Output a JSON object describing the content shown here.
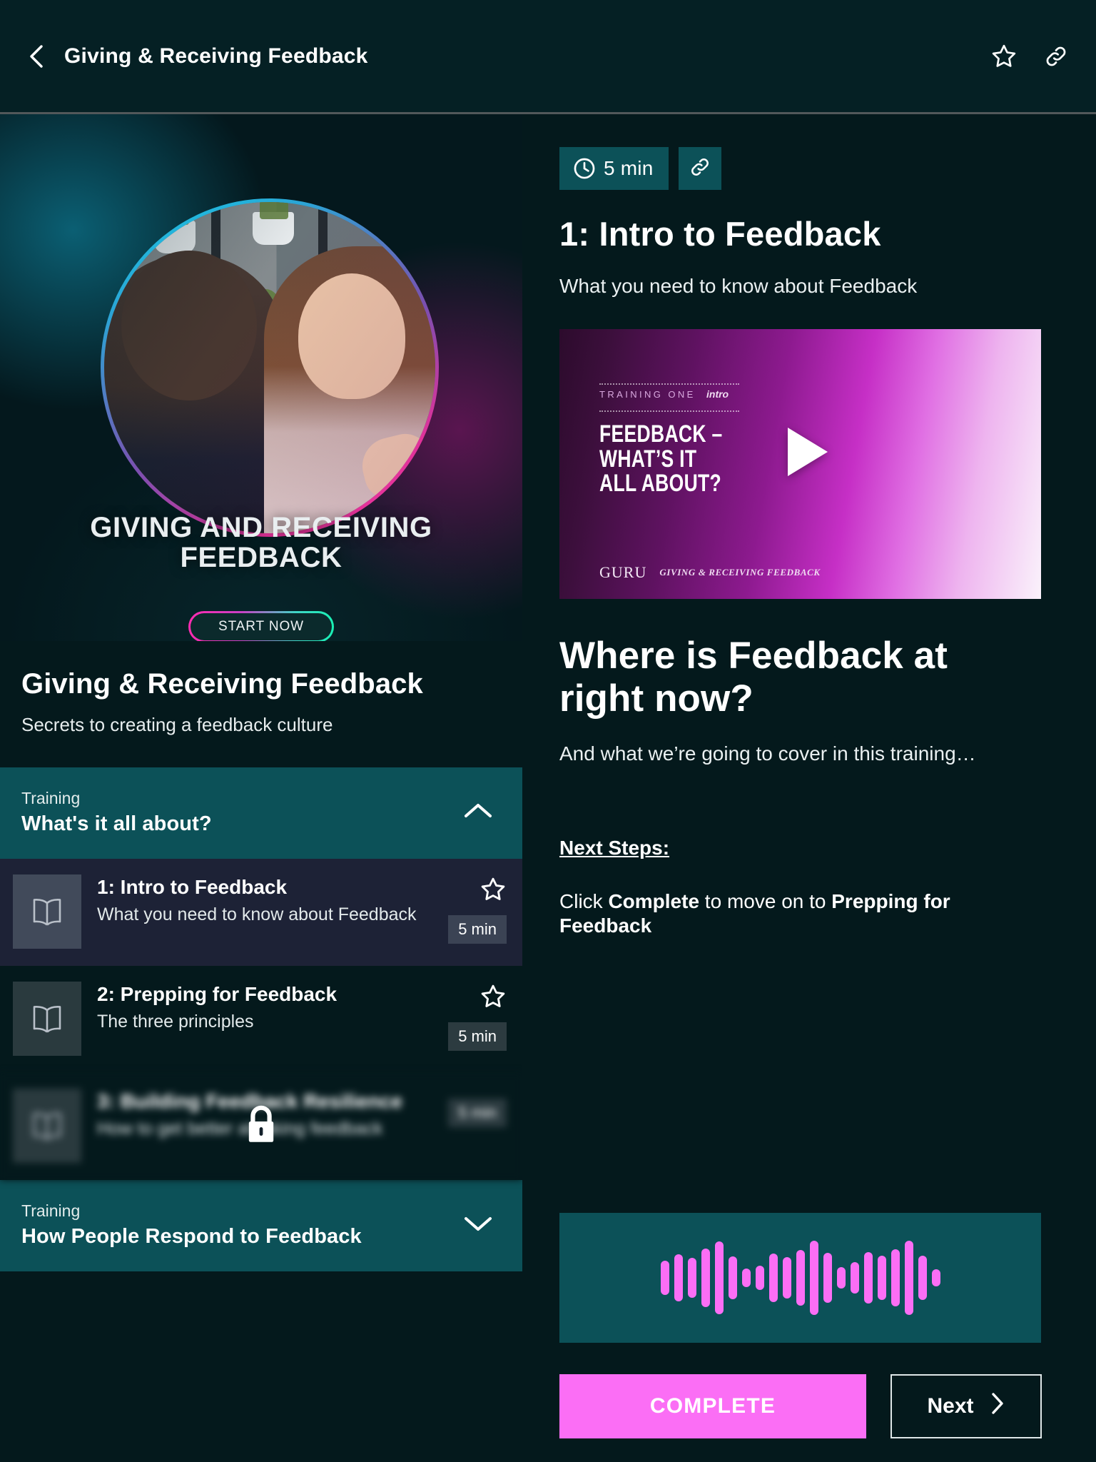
{
  "topbar": {
    "back_icon": "chevron-left-icon",
    "title": "Giving & Receiving Feedback",
    "favorite_icon": "star-outline-icon",
    "link_icon": "link-icon"
  },
  "hero": {
    "title": "GIVING AND RECEIVING FEEDBACK",
    "cta_label": "START NOW"
  },
  "course": {
    "title": "Giving & Receiving Feedback",
    "subtitle": "Secrets to creating a feedback culture"
  },
  "sections": [
    {
      "kicker": "Training",
      "name": "What's it all about?",
      "expanded": true,
      "chevron_icon": "chevron-up-icon"
    },
    {
      "kicker": "Training",
      "name": "How People Respond to Feedback",
      "expanded": false,
      "chevron_icon": "chevron-down-icon"
    }
  ],
  "lessons": [
    {
      "title": "1: Intro to Feedback",
      "subtitle": "What you need to know about Feedback",
      "duration": "5 min",
      "state": "active",
      "icon": "book-icon",
      "star_icon": "star-outline-icon"
    },
    {
      "title": "2: Prepping for Feedback",
      "subtitle": "The three principles",
      "duration": "5 min",
      "state": "available",
      "icon": "book-icon",
      "star_icon": "star-outline-icon"
    },
    {
      "title": "3: Building Feedback Resilience",
      "subtitle": "How to get better at taking feedback",
      "duration": "5 min",
      "state": "locked",
      "icon": "book-icon",
      "lock_icon": "lock-icon"
    }
  ],
  "detail": {
    "duration": "5 min",
    "clock_icon": "clock-icon",
    "link_icon": "link-icon",
    "title": "1: Intro to Feedback",
    "description": "What you need to know about Feedback",
    "video": {
      "kicker": "TRAINING ONE",
      "tag": "intro",
      "headline": "FEEDBACK –\nWHAT’S IT\nALL ABOUT?",
      "logo_mark": "GURU",
      "logo_text": "GIVING & RECEIVING FEEDBACK",
      "play_icon": "play-icon"
    },
    "heading": "Where is Feedback at right now?",
    "paragraph": "And what we’re going to cover in this training…",
    "next_steps_label": "Next Steps:",
    "next_steps_pre": "Click ",
    "next_steps_bold1": "Complete",
    "next_steps_mid": " to move on to ",
    "next_steps_bold2": "Prepping for Feedback",
    "audio_icon": "audio-waveform-icon",
    "complete_label": "COMPLETE",
    "next_label": "Next",
    "next_icon": "chevron-right-icon"
  },
  "colors": {
    "page_bg": "#04191c",
    "teal_panel": "#0c5158",
    "active_lesson_bg": "#1d2236",
    "accent_pink": "#fb6ef5",
    "accent_cyan": "#19f0b4"
  }
}
